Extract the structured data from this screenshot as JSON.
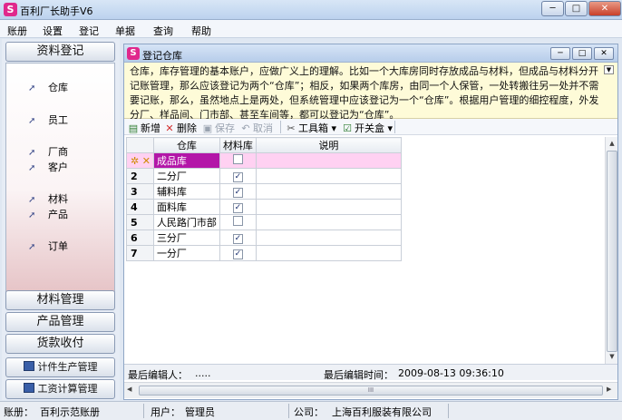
{
  "window": {
    "title": "百利厂长助手V6",
    "controls": {
      "minimize": "─",
      "maximize": "□",
      "close": "✕"
    }
  },
  "menu": [
    "账册",
    "设置",
    "登记",
    "单据",
    "查询",
    "帮助"
  ],
  "sidebar": {
    "header": "资料登记",
    "items": [
      "仓库",
      "员工",
      "厂商",
      "客户",
      "材料",
      "产品",
      "订单"
    ],
    "bottom_buttons": [
      "材料管理",
      "产品管理",
      "货款收付"
    ],
    "small_buttons": [
      "计件生产管理",
      "工资计算管理"
    ]
  },
  "child_window": {
    "title": "登记仓库",
    "description": "仓库，库存管理的基本账户，应做广义上的理解。比如一个大库房同时存放成品与材料，但成品与材料分开记账管理，那么应该登记为两个“仓库”；相反，如果两个库房，由同一个人保管，一处转搬往另一处并不需要记账，那么，虽然地点上是两处，但系统管理中应该登记为一个“仓库”。根据用户管理的细控程度，外发分厂、样品间、门市部、甚至车间等，都可以登记为“仓库”。"
  },
  "toolbar": {
    "new": "新增",
    "delete": "删除",
    "save": "保存",
    "cancel": "取消",
    "toolbox": "工具箱",
    "switchbox": "开关盒"
  },
  "table": {
    "headers": [
      "仓库",
      "材料库",
      "说明"
    ],
    "new_row": {
      "marker": "✲ ✕",
      "warehouse": "成品库",
      "material": false,
      "note": ""
    },
    "rows": [
      {
        "no": "2",
        "warehouse": "二分厂",
        "material": true,
        "note": ""
      },
      {
        "no": "3",
        "warehouse": "辅料库",
        "material": true,
        "note": ""
      },
      {
        "no": "4",
        "warehouse": "面料库",
        "material": true,
        "note": ""
      },
      {
        "no": "5",
        "warehouse": "人民路门市部",
        "material": false,
        "note": ""
      },
      {
        "no": "6",
        "warehouse": "三分厂",
        "material": true,
        "note": ""
      },
      {
        "no": "7",
        "warehouse": "一分厂",
        "material": true,
        "note": ""
      }
    ]
  },
  "record_status": {
    "last_editor_label": "最后编辑人：",
    "last_editor_value": ".....",
    "last_edit_time_label": "最后编辑时间：",
    "last_edit_time_value": "2009-08-13 09:36:10"
  },
  "hscroll_label": "III",
  "statusbar": {
    "book_label": "账册：",
    "book_value": "百利示范账册",
    "user_label": "用户：",
    "user_value": "管理员",
    "company_label": "公司：",
    "company_value": "上海百利服装有限公司"
  },
  "colors": {
    "accent_pink": "#e0288c",
    "new_row": "#ffd1f2",
    "selected_cell": "#b316a8",
    "description_bg": "#fefbd8"
  }
}
